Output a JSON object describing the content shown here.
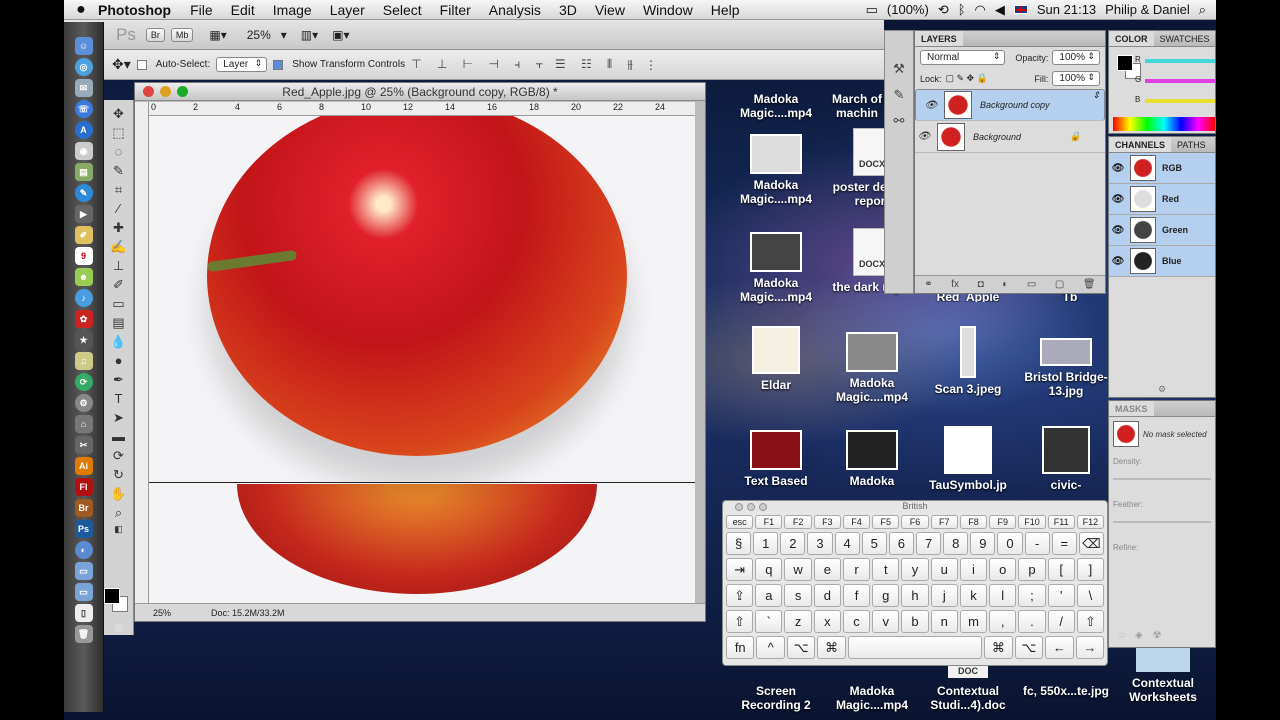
{
  "menubar": {
    "app": "Photoshop",
    "items": [
      "File",
      "Edit",
      "Image",
      "Layer",
      "Select",
      "Filter",
      "Analysis",
      "3D",
      "View",
      "Window",
      "Help"
    ],
    "battery": "(100%)",
    "clock": "Sun 21:13",
    "user": "Philip & Daniel"
  },
  "optbar": {
    "ps_logo": "Ps",
    "br_label": "Br",
    "mb_label": "Mb",
    "zoom": "25%",
    "auto_select_label": "Auto-Select:",
    "auto_select_value": "Layer",
    "show_transform_label": "Show Transform Controls"
  },
  "document": {
    "title": "Red_Apple.jpg @ 25% (Background copy, RGB/8) *",
    "ruler_marks": [
      "0",
      "2",
      "4",
      "6",
      "8",
      "10",
      "12",
      "14",
      "16",
      "18",
      "20",
      "22",
      "24"
    ],
    "zoom": "25%",
    "doc_info": "Doc: 15.2M/33.2M"
  },
  "desktop_icons": [
    {
      "label": "Madoka Magic....mp4"
    },
    {
      "label": "March of machin"
    },
    {
      "label": "Madoka Magic....mp4"
    },
    {
      "label": "poster design report",
      "badge": "DOCX"
    },
    {
      "label": "Madoka Magic....mp4"
    },
    {
      "label": "the dark night",
      "badge": "DOCX"
    },
    {
      "label": "Eldar"
    },
    {
      "label": "Madoka Magic....mp4"
    },
    {
      "label": "Scan 3.jpeg"
    },
    {
      "label": "Bristol Bridge-13.jpg"
    },
    {
      "label": "Text Based"
    },
    {
      "label": "Madoka"
    },
    {
      "label": "TauSymbol.jp"
    },
    {
      "label": "civic-"
    },
    {
      "label": "Screen Recording 2"
    },
    {
      "label": "Madoka Magic....mp4"
    },
    {
      "label": "Contextual Studi...4).doc",
      "badge": "DOC"
    },
    {
      "label": "fc, 550x...te.jpg"
    },
    {
      "label": "Contextual Worksheets"
    }
  ],
  "desktop_fragments": {
    "red_apple": "Red_Apple",
    "tb": "Tb"
  },
  "layers_panel": {
    "tab": "LAYERS",
    "blend_mode": "Normal",
    "opacity_label": "Opacity:",
    "opacity": "100%",
    "lock_label": "Lock:",
    "fill_label": "Fill:",
    "fill": "100%",
    "layers": [
      {
        "name": "Background copy",
        "selected": true
      },
      {
        "name": "Background",
        "selected": false,
        "locked": true
      }
    ]
  },
  "color_panel": {
    "tabs": [
      "COLOR",
      "SWATCHES"
    ],
    "channels": [
      "R",
      "G",
      "B"
    ],
    "colors": {
      "r": "#40d8d8",
      "g": "#e040e0",
      "b": "#e8e030"
    }
  },
  "channels_panel": {
    "tabs": [
      "CHANNELS",
      "PATHS"
    ],
    "channels": [
      "RGB",
      "Red",
      "Green",
      "Blue"
    ]
  },
  "masks_panel": {
    "tab": "MASKS",
    "status": "No mask selected",
    "density_label": "Density:",
    "feather_label": "Feather:",
    "refine_label": "Refine:"
  },
  "keyboard_viewer": {
    "title": "British",
    "rows": [
      [
        "esc",
        "F1",
        "F2",
        "F3",
        "F4",
        "F5",
        "F6",
        "F7",
        "F8",
        "F9",
        "F10",
        "F11",
        "F12"
      ],
      [
        "§",
        "1",
        "2",
        "3",
        "4",
        "5",
        "6",
        "7",
        "8",
        "9",
        "0",
        "-",
        "=",
        "⌫"
      ],
      [
        "⇥",
        "q",
        "w",
        "e",
        "r",
        "t",
        "y",
        "u",
        "i",
        "o",
        "p",
        "[",
        "]"
      ],
      [
        "⇪",
        "a",
        "s",
        "d",
        "f",
        "g",
        "h",
        "j",
        "k",
        "l",
        ";",
        "'",
        "\\"
      ],
      [
        "⇧",
        "`",
        "z",
        "x",
        "c",
        "v",
        "b",
        "n",
        "m",
        ",",
        ".",
        "/",
        "⇧"
      ],
      [
        "fn",
        "^",
        "⌥",
        "⌘",
        " ",
        "⌘",
        "⌥",
        "←",
        "→"
      ]
    ]
  }
}
